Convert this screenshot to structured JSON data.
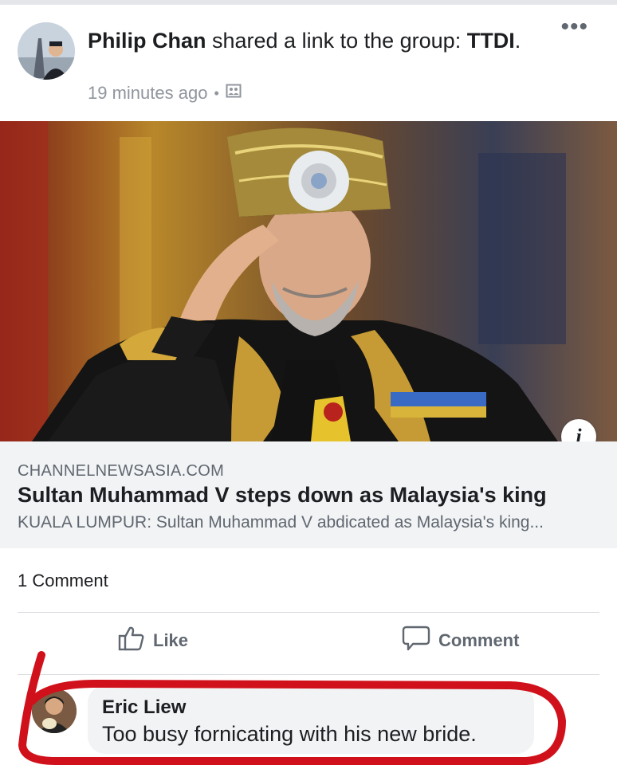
{
  "post": {
    "author": "Philip Chan",
    "action_text": " shared a link to the group: ",
    "group": "TTDI",
    "group_suffix": ".",
    "time": "19 minutes ago",
    "separator": "•",
    "privacy_icon": "group-privacy-icon",
    "more_label": "•••"
  },
  "link": {
    "domain": "CHANNELNEWSASIA.COM",
    "headline": "Sultan Muhammad V steps down as Malaysia's king",
    "snippet": "KUALA LUMPUR: Sultan Muhammad V abdicated as Malaysia's king...",
    "info_label": "i"
  },
  "engagement": {
    "comment_count": "1 Comment"
  },
  "actions": {
    "like_label": "Like",
    "like_icon": "thumbs-up-icon",
    "comment_label": "Comment",
    "comment_icon": "speech-bubble-icon"
  },
  "comment": {
    "author": "Eric Liew",
    "text": "Too busy fornicating with his new bride."
  },
  "colors": {
    "text_primary": "#1c1e21",
    "text_secondary": "#606770",
    "caption_bg": "#f2f3f5",
    "annotation_red": "#d0111b"
  }
}
